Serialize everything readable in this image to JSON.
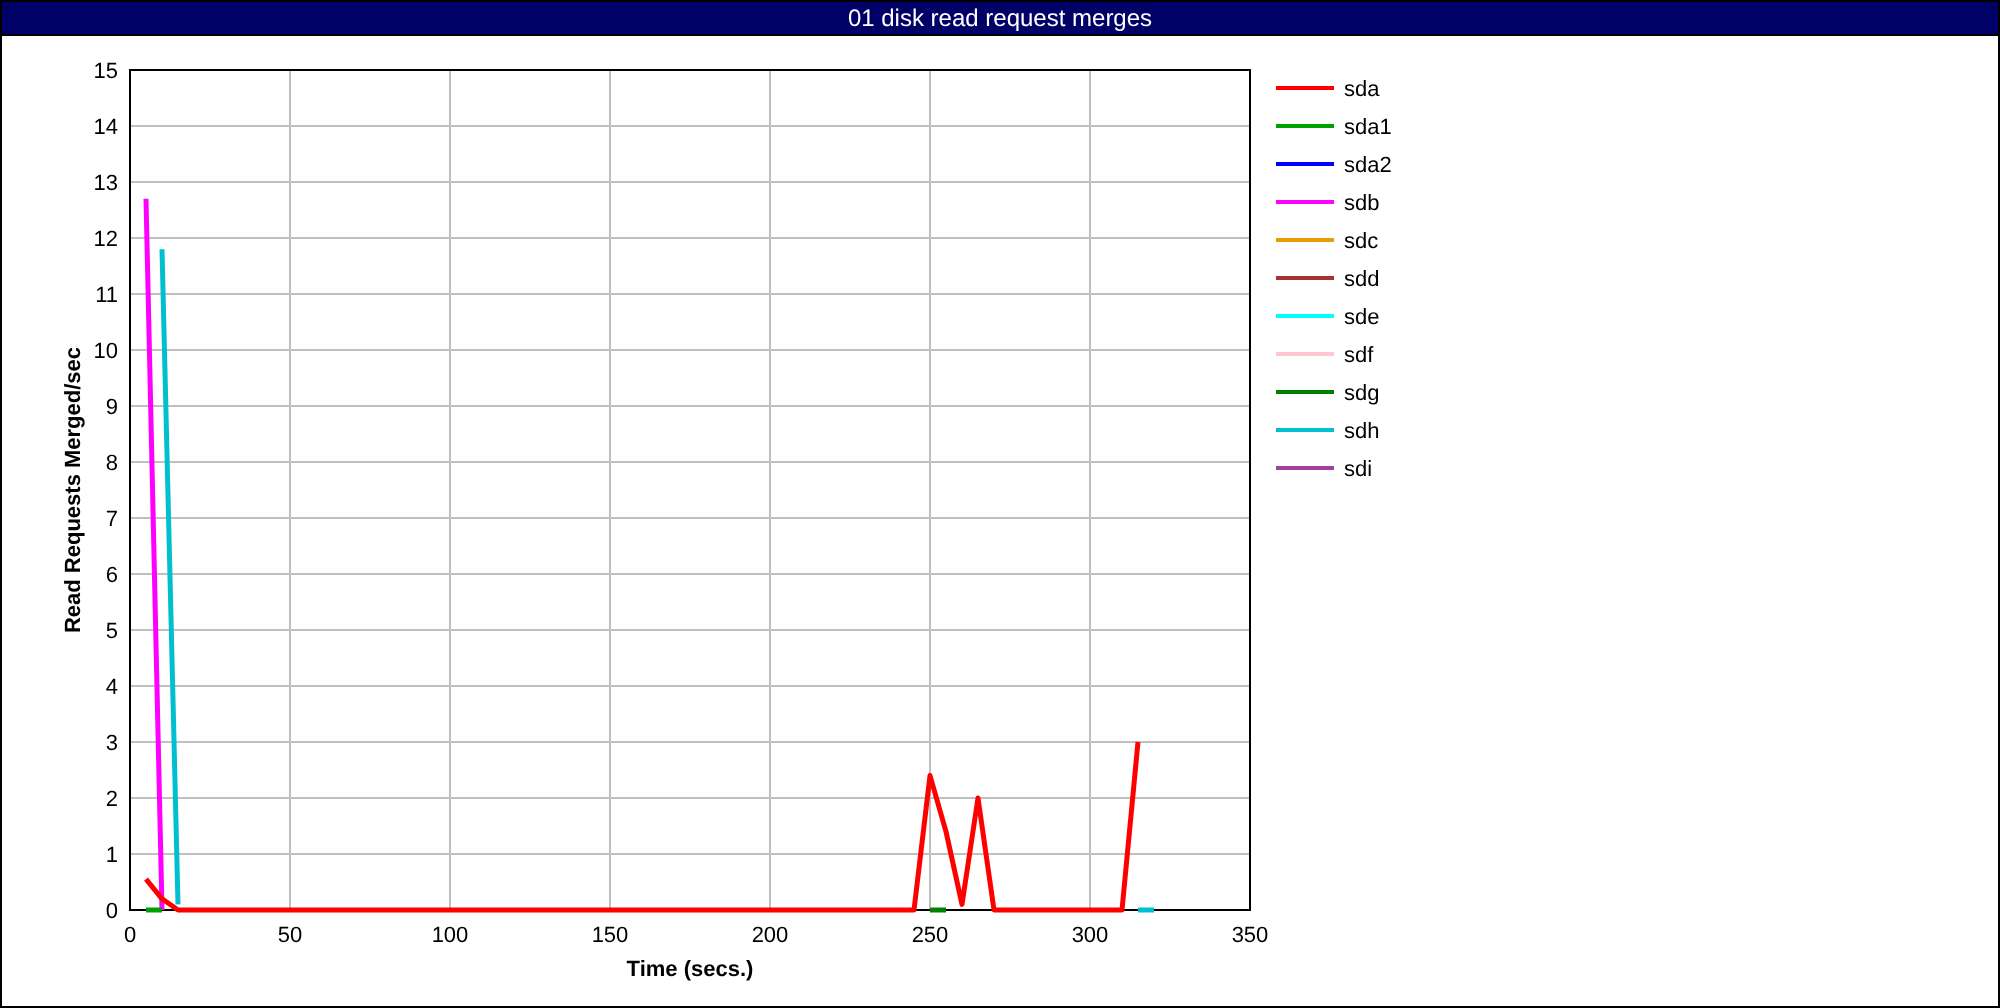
{
  "chart_data": {
    "type": "line",
    "title": "01 disk read request merges",
    "xlabel": "Time (secs.)",
    "ylabel": "Read Requests Merged/sec",
    "x": [
      5,
      10,
      15,
      20,
      25,
      30,
      35,
      40,
      45,
      50,
      55,
      60,
      65,
      70,
      75,
      80,
      85,
      90,
      95,
      100,
      105,
      110,
      115,
      120,
      125,
      130,
      135,
      140,
      145,
      150,
      155,
      160,
      165,
      170,
      175,
      180,
      185,
      190,
      195,
      200,
      205,
      210,
      215,
      220,
      225,
      230,
      235,
      240,
      245,
      250,
      255,
      260,
      265,
      270,
      275,
      280,
      285,
      290,
      295,
      300,
      305,
      310,
      315,
      320
    ],
    "xlim": [
      0,
      350
    ],
    "ylim": [
      0,
      15
    ],
    "xticks": [
      0,
      50,
      100,
      150,
      200,
      250,
      300,
      350
    ],
    "yticks": [
      0,
      1,
      2,
      3,
      4,
      5,
      6,
      7,
      8,
      9,
      10,
      11,
      12,
      13,
      14,
      15
    ],
    "grid": true,
    "legend": true,
    "series": [
      {
        "name": "sda",
        "color": "#ff0000",
        "values": [
          0.55,
          0.2,
          0,
          0,
          0,
          0,
          0,
          0,
          0,
          0,
          0,
          0,
          0,
          0,
          0,
          0,
          0,
          0,
          0,
          0,
          0,
          0,
          0,
          0,
          0,
          0,
          0,
          0,
          0,
          0,
          0,
          0,
          0,
          0,
          0,
          0,
          0,
          0,
          0,
          0,
          0,
          0,
          0,
          0,
          0,
          0,
          0,
          0,
          0,
          2.4,
          1.4,
          0.1,
          2.0,
          0,
          0,
          0,
          0,
          0,
          0,
          0,
          0,
          0,
          3.0,
          null
        ]
      },
      {
        "name": "sda1",
        "color": "#00a000",
        "values": [
          0,
          0,
          null,
          null,
          null,
          null,
          null,
          null,
          null,
          null,
          null,
          null,
          null,
          null,
          null,
          null,
          null,
          null,
          null,
          null,
          null,
          null,
          null,
          null,
          null,
          null,
          null,
          null,
          null,
          null,
          null,
          null,
          null,
          null,
          null,
          null,
          null,
          null,
          null,
          null,
          null,
          null,
          null,
          null,
          null,
          null,
          null,
          null,
          null,
          null,
          null,
          null,
          null,
          null,
          null,
          null,
          null,
          null,
          null,
          null,
          null,
          null,
          null,
          null
        ]
      },
      {
        "name": "sda2",
        "color": "#0000ff",
        "values": [
          null,
          null,
          null,
          null,
          null,
          null,
          null,
          null,
          null,
          null,
          null,
          null,
          null,
          null,
          null,
          null,
          null,
          null,
          null,
          null,
          null,
          null,
          null,
          null,
          null,
          null,
          null,
          null,
          null,
          null,
          null,
          null,
          null,
          null,
          null,
          null,
          null,
          null,
          null,
          null,
          null,
          null,
          null,
          null,
          null,
          null,
          null,
          null,
          null,
          null,
          null,
          null,
          null,
          null,
          null,
          null,
          null,
          null,
          null,
          null,
          null,
          null,
          null,
          null
        ]
      },
      {
        "name": "sdb",
        "color": "#ff00ff",
        "values": [
          12.7,
          0,
          null,
          null,
          null,
          null,
          null,
          null,
          null,
          null,
          null,
          null,
          null,
          null,
          null,
          null,
          null,
          null,
          null,
          null,
          null,
          null,
          null,
          null,
          null,
          null,
          null,
          null,
          null,
          null,
          null,
          null,
          null,
          null,
          null,
          null,
          null,
          null,
          null,
          null,
          null,
          null,
          null,
          null,
          null,
          null,
          null,
          null,
          null,
          null,
          null,
          null,
          null,
          null,
          null,
          null,
          null,
          null,
          null,
          null,
          null,
          null,
          null,
          null
        ]
      },
      {
        "name": "sdc",
        "color": "#e8a000",
        "values": [
          null,
          null,
          null,
          null,
          null,
          null,
          null,
          null,
          null,
          null,
          null,
          null,
          null,
          null,
          null,
          null,
          null,
          null,
          null,
          null,
          null,
          null,
          null,
          null,
          null,
          null,
          null,
          null,
          null,
          null,
          null,
          null,
          null,
          null,
          null,
          null,
          null,
          null,
          null,
          null,
          null,
          null,
          null,
          null,
          null,
          null,
          null,
          null,
          null,
          null,
          null,
          null,
          null,
          null,
          null,
          null,
          null,
          null,
          null,
          null,
          null,
          null,
          null,
          null
        ]
      },
      {
        "name": "sdd",
        "color": "#a83232",
        "values": [
          null,
          null,
          null,
          null,
          null,
          null,
          null,
          null,
          null,
          null,
          null,
          null,
          null,
          null,
          null,
          null,
          null,
          null,
          null,
          null,
          null,
          null,
          null,
          null,
          null,
          null,
          null,
          null,
          null,
          null,
          null,
          null,
          null,
          null,
          null,
          null,
          null,
          null,
          null,
          null,
          null,
          null,
          null,
          null,
          null,
          null,
          null,
          null,
          null,
          null,
          null,
          null,
          null,
          null,
          null,
          null,
          null,
          null,
          null,
          null,
          null,
          null,
          null,
          null
        ]
      },
      {
        "name": "sde",
        "color": "#00ffff",
        "values": [
          null,
          null,
          null,
          null,
          null,
          null,
          null,
          null,
          null,
          null,
          null,
          null,
          null,
          null,
          null,
          null,
          null,
          null,
          null,
          null,
          null,
          null,
          null,
          null,
          null,
          null,
          null,
          null,
          null,
          null,
          null,
          null,
          null,
          null,
          null,
          null,
          null,
          null,
          null,
          null,
          null,
          null,
          null,
          null,
          null,
          null,
          null,
          null,
          null,
          null,
          null,
          null,
          null,
          null,
          null,
          null,
          null,
          null,
          null,
          null,
          null,
          null,
          null,
          null
        ]
      },
      {
        "name": "sdf",
        "color": "#ffc8d0",
        "values": [
          null,
          null,
          null,
          null,
          null,
          null,
          null,
          null,
          null,
          null,
          null,
          null,
          null,
          null,
          null,
          null,
          null,
          null,
          null,
          null,
          null,
          null,
          null,
          null,
          null,
          null,
          null,
          null,
          null,
          null,
          null,
          null,
          null,
          null,
          null,
          null,
          null,
          null,
          null,
          null,
          null,
          null,
          null,
          null,
          null,
          null,
          null,
          null,
          null,
          null,
          null,
          null,
          null,
          null,
          null,
          null,
          null,
          null,
          null,
          null,
          null,
          null,
          null,
          null
        ]
      },
      {
        "name": "sdg",
        "color": "#008000",
        "values": [
          null,
          null,
          null,
          null,
          null,
          null,
          null,
          null,
          null,
          null,
          null,
          null,
          null,
          null,
          null,
          null,
          null,
          null,
          null,
          null,
          null,
          null,
          null,
          null,
          null,
          null,
          null,
          null,
          null,
          null,
          null,
          null,
          null,
          null,
          null,
          null,
          null,
          null,
          null,
          null,
          null,
          null,
          null,
          null,
          null,
          null,
          null,
          null,
          null,
          0,
          0,
          null,
          null,
          null,
          null,
          null,
          null,
          null,
          null,
          null,
          null,
          null,
          null,
          null
        ]
      },
      {
        "name": "sdh",
        "color": "#00c0d0",
        "values": [
          null,
          11.8,
          0.1,
          null,
          null,
          null,
          null,
          null,
          null,
          null,
          null,
          null,
          null,
          null,
          null,
          null,
          null,
          null,
          null,
          null,
          null,
          null,
          null,
          null,
          null,
          null,
          null,
          null,
          null,
          null,
          null,
          null,
          null,
          null,
          null,
          null,
          null,
          null,
          null,
          null,
          null,
          null,
          null,
          null,
          null,
          null,
          null,
          null,
          null,
          null,
          null,
          null,
          null,
          null,
          null,
          null,
          null,
          null,
          null,
          null,
          null,
          null,
          0,
          0
        ]
      },
      {
        "name": "sdi",
        "color": "#a040a0",
        "values": [
          null,
          null,
          null,
          null,
          null,
          null,
          null,
          null,
          null,
          null,
          null,
          null,
          null,
          null,
          null,
          null,
          null,
          null,
          null,
          null,
          null,
          null,
          null,
          null,
          null,
          null,
          null,
          null,
          null,
          null,
          null,
          null,
          null,
          null,
          null,
          null,
          null,
          null,
          null,
          null,
          null,
          null,
          null,
          null,
          null,
          null,
          null,
          null,
          null,
          null,
          null,
          null,
          null,
          null,
          null,
          null,
          null,
          null,
          null,
          null,
          null,
          null,
          null,
          null
        ]
      }
    ]
  }
}
